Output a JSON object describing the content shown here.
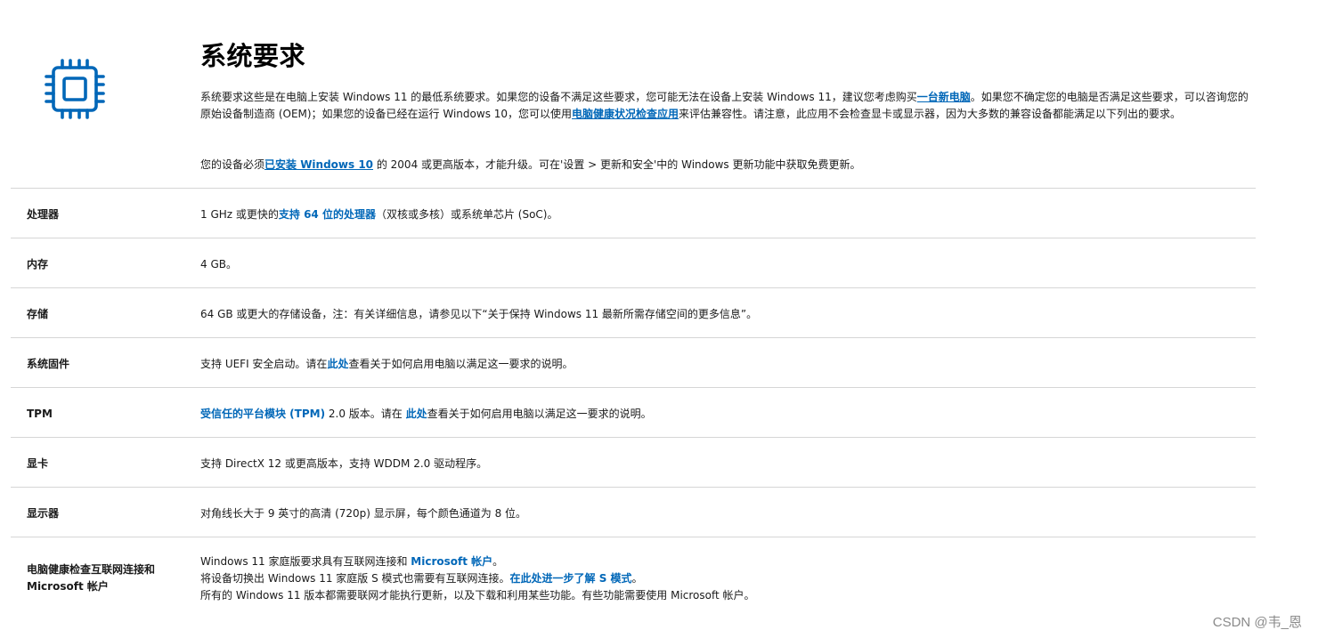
{
  "header": {
    "title": "系统要求"
  },
  "intro": {
    "p1_a": "系统要求这些是在电脑上安装 Windows 11 的最低系统要求。如果您的设备不满足这些要求，您可能无法在设备上安装 Windows 11，建议您考虑购买",
    "p1_link1": "一台新电脑",
    "p1_b": "。如果您不确定您的电脑是否满足这些要求，可以咨询您的原始设备制造商 (OEM)；如果您的设备已经在运行 Windows 10，您可以使用",
    "p1_link2": "电脑健康状况检查应用",
    "p1_c": "来评估兼容性。请注意，此应用不会检查显卡或显示器，因为大多数的兼容设备都能满足以下列出的要求。",
    "p2_a": "您的设备必须",
    "p2_link": "已安装 Windows 10",
    "p2_b": " 的 2004 或更高版本，才能升级。可在'设置 > 更新和安全'中的 Windows 更新功能中获取免费更新。"
  },
  "requirements": {
    "processor": {
      "label": "处理器",
      "a": "1 GHz 或更快的",
      "link": "支持 64 位的处理器",
      "b": "（双核或多核）或系统单芯片 (SoC)。"
    },
    "memory": {
      "label": "内存",
      "value": "4 GB。"
    },
    "storage": {
      "label": "存储",
      "value": "64 GB 或更大的存储设备，注：有关详细信息，请参见以下“关于保持 Windows 11 最新所需存储空间的更多信息”。"
    },
    "firmware": {
      "label": "系统固件",
      "a": "支持 UEFI 安全启动。请在",
      "link": "此处",
      "b": "查看关于如何启用电脑以满足这一要求的说明。"
    },
    "tpm": {
      "label": "TPM",
      "link1": "受信任的平台模块 (TPM)",
      "a": " 2.0 版本。请在 ",
      "link2": "此处",
      "b": "查看关于如何启用电脑以满足这一要求的说明。"
    },
    "graphics": {
      "label": "显卡",
      "value": "支持 DirectX 12 或更高版本，支持 WDDM 2.0 驱动程序。"
    },
    "display": {
      "label": "显示器",
      "value": "对角线长大于 9 英寸的高清 (720p) 显示屏，每个颜色通道为 8 位。"
    },
    "internet": {
      "label": "电脑健康检查互联网连接和 Microsoft 帐户",
      "line1_a": "Windows 11 家庭版要求具有互联网连接和 ",
      "line1_link": "Microsoft 帐户",
      "line1_b": "。",
      "line2_a": "将设备切换出 Windows 11 家庭版 S 模式也需要有互联网连接。",
      "line2_link": "在此处进一步了解 S 模式",
      "line2_b": "。",
      "line3": "所有的 Windows 11 版本都需要联网才能执行更新，以及下载和利用某些功能。有些功能需要使用 Microsoft 帐户。"
    }
  },
  "watermark": "CSDN @韦_恩",
  "icons": {
    "chip": "cpu-chip-icon"
  },
  "colors": {
    "link": "#0067b8",
    "icon": "#0067b8",
    "divider": "#d6d6d6"
  }
}
